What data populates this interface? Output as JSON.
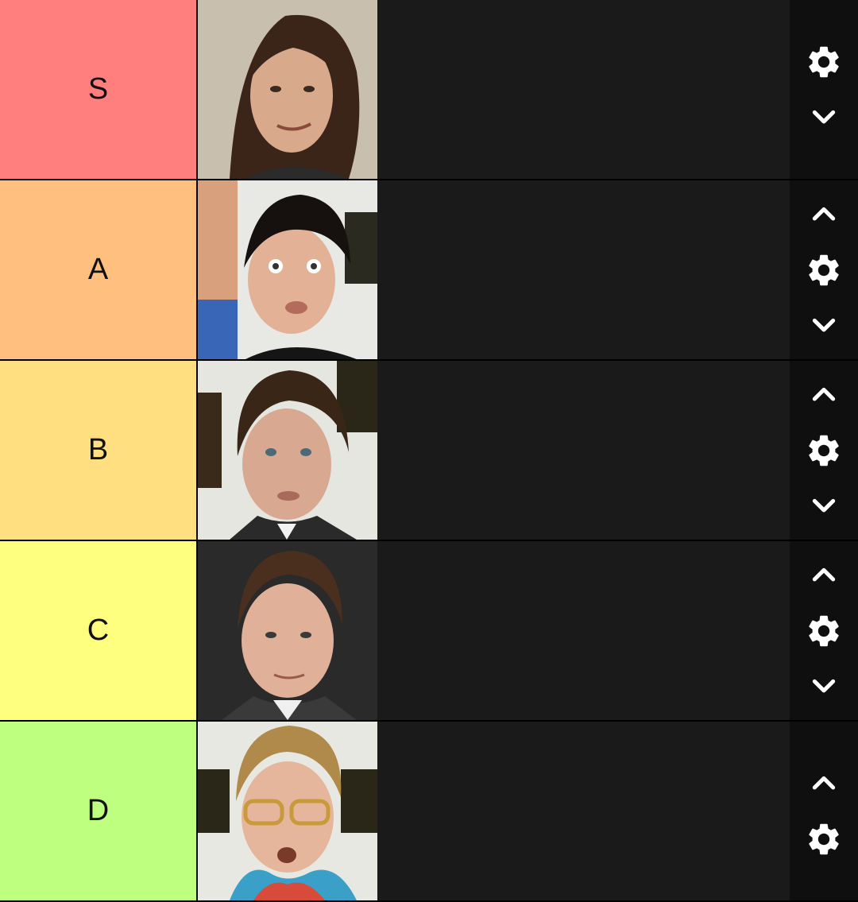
{
  "tiers": [
    {
      "label": "S",
      "color": "#ff7f7f",
      "has_up": false,
      "has_down": true,
      "item_name": "portrait-photo"
    },
    {
      "label": "A",
      "color": "#ffbf7f",
      "has_up": true,
      "has_down": true,
      "item_name": "portrait-photo"
    },
    {
      "label": "B",
      "color": "#ffdf7f",
      "has_up": true,
      "has_down": true,
      "item_name": "portrait-photo"
    },
    {
      "label": "C",
      "color": "#ffff7f",
      "has_up": true,
      "has_down": true,
      "item_name": "portrait-photo"
    },
    {
      "label": "D",
      "color": "#bfff7f",
      "has_up": true,
      "has_down": false,
      "item_name": "portrait-photo"
    }
  ],
  "icons": {
    "settings": "gear-icon",
    "move_up": "chevron-up-icon",
    "move_down": "chevron-down-icon"
  },
  "colors": {
    "items_background": "#1a1a1a",
    "controls_background": "#0f0f0f",
    "icon_color": "#ffffff"
  }
}
